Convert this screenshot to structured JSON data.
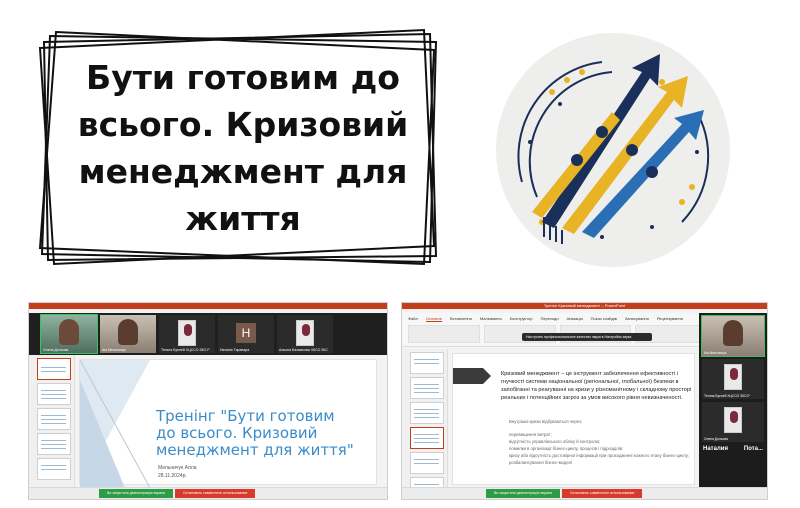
{
  "title": "Бути готовим до\nвсього. Кризовий\nменеджмент для\nжиття",
  "left_screenshot": {
    "participants": [
      {
        "name": "Олена Дольова"
      },
      {
        "name": "Ala Мельничук"
      },
      {
        "name": "Тетяна Буєлей ХЦССО ЗКО.Р"
      },
      {
        "name": "Наталія Тарапара",
        "initial": "Н"
      },
      {
        "name": "Альона Бахмасова ХКСО ЗКС"
      }
    ],
    "slide_title": "Тренінг \"Бути готовим до всього. Кризовий менеджмент для життя\"",
    "slide_author": "Мельничук Алла",
    "slide_date": "28.11.2024р.",
    "share_status": "Ви запустили демонстрацію екрана",
    "stop_share": "Остановить совместное использование"
  },
  "right_screenshot": {
    "window_title": "Тренінг Кризовий менеджмент – PowerPoint",
    "ribbon_tabs": [
      "Файл",
      "Основне",
      "Вставлення",
      "Малювання",
      "Конструктор",
      "Переходи",
      "Анімація",
      "Показ слайдів",
      "Записування",
      "Рецензування",
      "Подання",
      "Довідка"
    ],
    "notice": "Настроить профессиональное качество звука в Настройки звука",
    "heading": "Кризовий менеджмент – це інструмент забезпечення ефективності і гнучкості системи національної (регіональної, глобальної) безпеки в запобіганні та реагуванні на кризи у різноманітному і складному просторі реальних і потенційних загроз за умов високого рівня невизначеності.",
    "body_intro": "Внутрішні кризи відбуваються через:",
    "body_items": [
      "перевищення витрат;",
      "відсутність управлінського обліку й контролю;",
      "помилки в організації бізнес-циклу, процесів і підрозділів;",
      "кризу або відсутність достовірної інформації при проходженні кожного етапу бізнес-циклу;",
      "розбалансування бізнес-моделі"
    ],
    "participants": [
      {
        "name": "Ala Мельничук"
      },
      {
        "name": "Тетяна Буєлей ХЦССО ЗКО.Р"
      },
      {
        "name": "Олена Дольова"
      }
    ],
    "bottom_names": [
      "Наталия",
      "Пота..."
    ],
    "share_status": "Ви запустили демонстрацію екрана",
    "stop_share": "Остановить совместное использование"
  },
  "colors": {
    "slide_title": "#3a8cc9",
    "accent_red": "#c43e1c",
    "logo_blue": "#2a6fb5",
    "logo_yellow": "#e8b325",
    "logo_navy": "#1a2f5a"
  }
}
